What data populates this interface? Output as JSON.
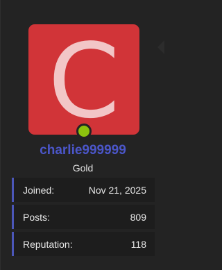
{
  "profile": {
    "avatar_letter": "C",
    "avatar_color": "#d13438",
    "status_color": "#8cc20e",
    "username": "charlie999999",
    "username_color": "#4b56c9",
    "rank": "Gold"
  },
  "stats": [
    {
      "label": "Joined:",
      "value": "Nov 21, 2025"
    },
    {
      "label": "Posts:",
      "value": "809"
    },
    {
      "label": "Reputation:",
      "value": "118"
    }
  ]
}
